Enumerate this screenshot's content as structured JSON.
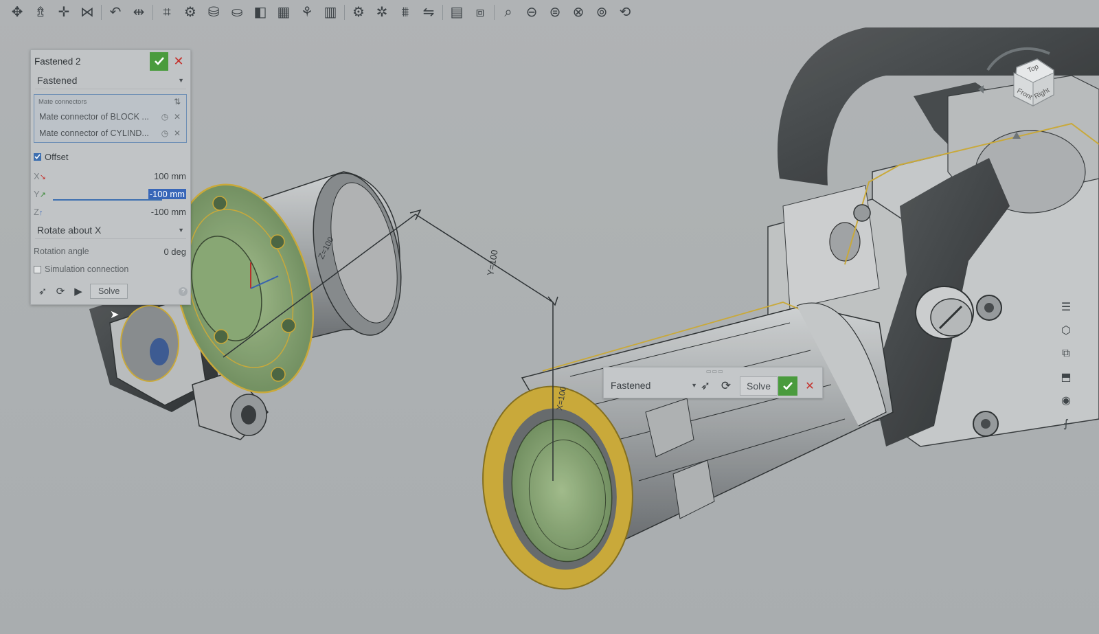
{
  "toolbar": {
    "tools": [
      {
        "name": "transform-icon",
        "glyph": "✥"
      },
      {
        "name": "insert-icon",
        "glyph": "⇯"
      },
      {
        "name": "move-icon",
        "glyph": "✛"
      },
      {
        "name": "mate-icon",
        "glyph": "⋈"
      },
      {
        "name": "sep"
      },
      {
        "name": "group-icon",
        "glyph": "↶"
      },
      {
        "name": "distance-icon",
        "glyph": "⇹"
      },
      {
        "name": "sep"
      },
      {
        "name": "mate-connector-icon",
        "glyph": "⌗"
      },
      {
        "name": "fastened-mate-icon",
        "glyph": "⚙"
      },
      {
        "name": "revolute-mate-icon",
        "glyph": "⛁"
      },
      {
        "name": "slider-mate-icon",
        "glyph": "⛀"
      },
      {
        "name": "planar-mate-icon",
        "glyph": "◧"
      },
      {
        "name": "cylindrical-mate-icon",
        "glyph": "▦"
      },
      {
        "name": "pin-slot-mate-icon",
        "glyph": "⚘"
      },
      {
        "name": "ball-mate-icon",
        "glyph": "▥"
      },
      {
        "name": "sep"
      },
      {
        "name": "gear-relation-icon",
        "glyph": "⚙"
      },
      {
        "name": "rack-pinion-icon",
        "glyph": "✲"
      },
      {
        "name": "screw-relation-icon",
        "glyph": "⩩"
      },
      {
        "name": "linear-relation-icon",
        "glyph": "⇋"
      },
      {
        "name": "sep"
      },
      {
        "name": "replicate-icon",
        "glyph": "▤"
      },
      {
        "name": "pattern-icon",
        "glyph": "⧈"
      },
      {
        "name": "sep"
      },
      {
        "name": "measure-icon",
        "glyph": "⌕"
      },
      {
        "name": "section-view-icon",
        "glyph": "⊖"
      },
      {
        "name": "explode-view-icon",
        "glyph": "⊜"
      },
      {
        "name": "interference-icon",
        "glyph": "⊗"
      },
      {
        "name": "mate-limits-icon",
        "glyph": "⊚"
      },
      {
        "name": "animate-icon",
        "glyph": "⟲"
      }
    ]
  },
  "panel": {
    "title": "Fastened 2",
    "mate_type": "Fastened",
    "mate_connectors_label": "Mate connectors",
    "connectors": [
      "Mate connector of BLOCK ...",
      "Mate connector of CYLIND..."
    ],
    "offset_label": "Offset",
    "x_label": "X",
    "x_value": "100 mm",
    "y_label": "Y",
    "y_value": "-100 mm",
    "z_label": "Z",
    "z_value": "-100 mm",
    "rotate_option": "Rotate about X",
    "rotation_label": "Rotation angle",
    "rotation_value": "0 deg",
    "simulation_label": "Simulation connection",
    "solve_label": "Solve",
    "help_glyph": "?"
  },
  "mini_toolbar": {
    "mate_type": "Fastened",
    "solve_label": "Solve"
  },
  "viewport": {
    "dim_z": "Z=100",
    "dim_y": "Y=100",
    "dim_x": "X=100"
  },
  "view_cube": {
    "top": "Top",
    "front": "Front",
    "right": "Right"
  },
  "dock": [
    {
      "name": "assembly-list-icon",
      "glyph": "☰"
    },
    {
      "name": "appearance-icon",
      "glyph": "⬡"
    },
    {
      "name": "instance-tree-icon",
      "glyph": "⧉"
    },
    {
      "name": "section-icon",
      "glyph": "⬒"
    },
    {
      "name": "render-icon",
      "glyph": "◉"
    },
    {
      "name": "variables-icon",
      "glyph": "⨍"
    }
  ],
  "colors": {
    "accent_blue": "#3866b8",
    "confirm_green": "#4a9b3d",
    "cancel_red": "#c4312c",
    "highlight_yellow": "#d4b23c",
    "face_green": "#8fb07a"
  }
}
